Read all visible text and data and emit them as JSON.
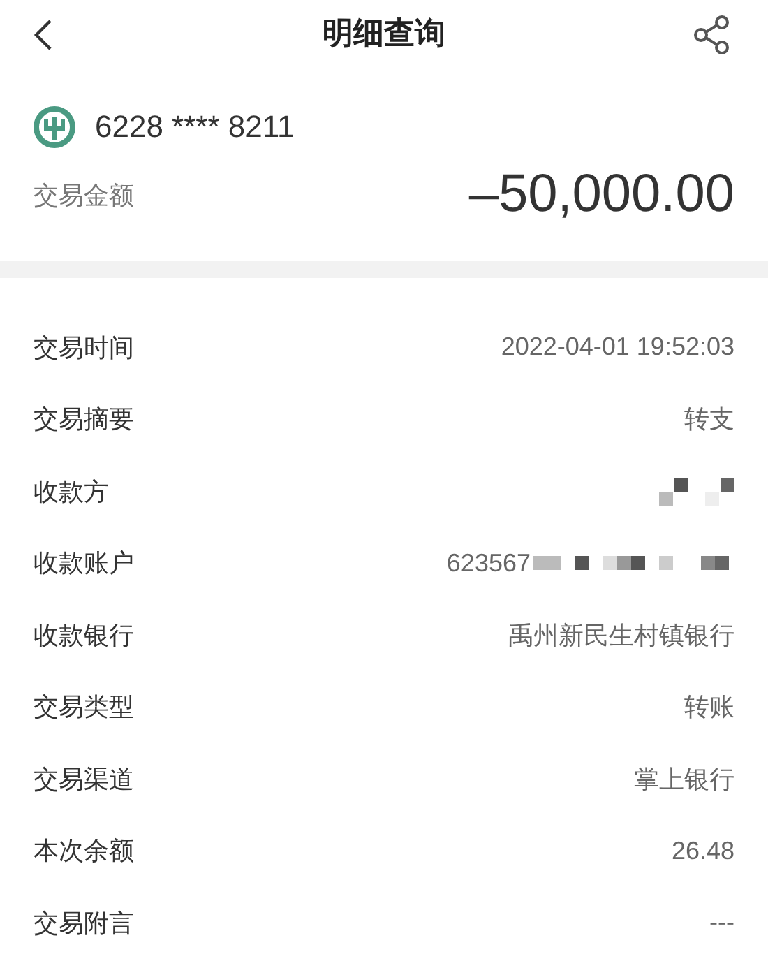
{
  "header": {
    "title": "明细查询"
  },
  "account": {
    "card_number": "6228 **** 8211",
    "amount_label": "交易金额",
    "amount": "–50,000.00"
  },
  "details": [
    {
      "label": "交易时间",
      "value": "2022-04-01 19:52:03"
    },
    {
      "label": "交易摘要",
      "value": "转支"
    },
    {
      "label": "收款方",
      "redacted": true
    },
    {
      "label": "收款账户",
      "value": "623567",
      "redacted": true
    },
    {
      "label": "收款银行",
      "value": "禹州新民生村镇银行"
    },
    {
      "label": "交易类型",
      "value": "转账"
    },
    {
      "label": "交易渠道",
      "value": "掌上银行"
    },
    {
      "label": "本次余额",
      "value": "26.48"
    },
    {
      "label": "交易附言",
      "value": "---"
    }
  ]
}
